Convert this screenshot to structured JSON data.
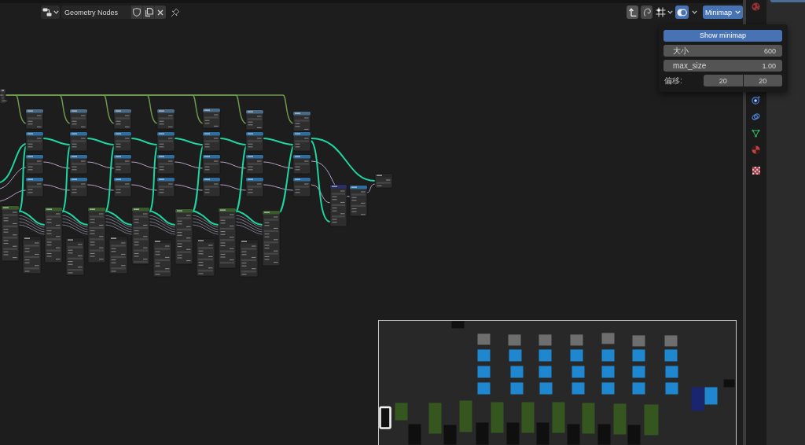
{
  "header": {
    "node_tree": {
      "value": "Geometry Nodes"
    },
    "overlays": {
      "on": true
    },
    "minimap_menu": {
      "label": "Minimap",
      "open": true
    }
  },
  "minimap_popup": {
    "show_minimap": {
      "label": "Show minimap",
      "on": true
    },
    "fields": [
      {
        "label": "大小",
        "value": "600"
      },
      {
        "label": "max_size",
        "value": "1.00"
      }
    ],
    "offset": {
      "label": "偏移:",
      "values": [
        "20",
        "20"
      ]
    }
  }
}
